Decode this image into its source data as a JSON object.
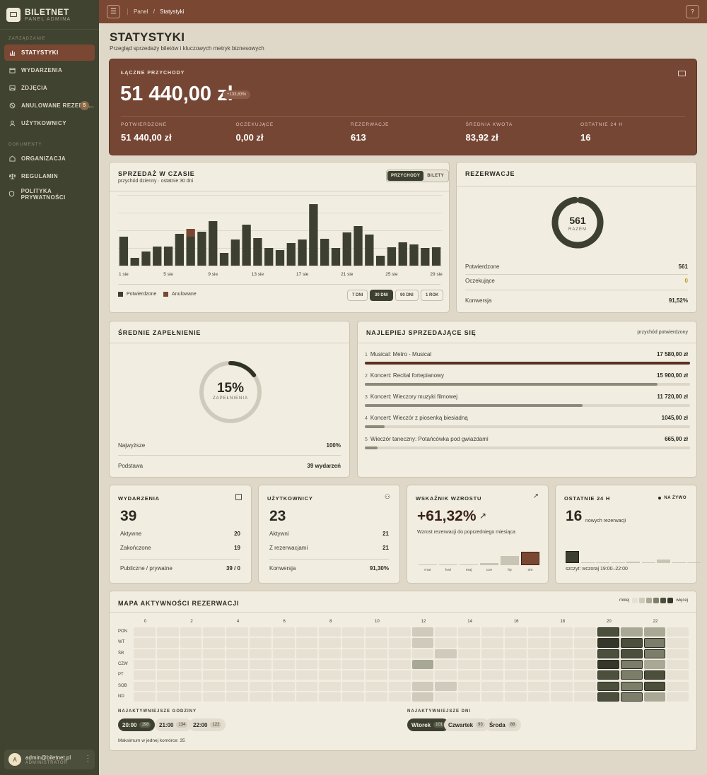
{
  "brand": {
    "name": "BILETNET",
    "sub": "PANEL ADMINA"
  },
  "sidebar": {
    "section1": "ZARZĄDZANIE",
    "items": [
      {
        "label": "STATYSTYKI",
        "icon": "bar-chart-icon",
        "active": true
      },
      {
        "label": "WYDARZENIA",
        "icon": "calendar-icon"
      },
      {
        "label": "ZDJĘCIA",
        "icon": "image-icon"
      },
      {
        "label": "ANULOWANE REZERW...",
        "icon": "cancel-icon",
        "badge": "5"
      },
      {
        "label": "UŻYTKOWNICY",
        "icon": "user-icon"
      }
    ],
    "section2": "DOKUMENTY",
    "docs": [
      {
        "label": "ORGANIZACJA",
        "icon": "building-icon"
      },
      {
        "label": "REGULAMIN",
        "icon": "scale-icon"
      },
      {
        "label": "POLITYKA PRYWATNOŚCI",
        "icon": "shield-icon"
      }
    ],
    "user": {
      "avatar": "A",
      "email": "admin@biletnet.pl",
      "role": "ADMINISTRATOR"
    }
  },
  "topbar": {
    "crumb_root": "Panel",
    "crumb_sep": "/",
    "crumb_current": "Statystyki",
    "help": "?"
  },
  "page": {
    "title": "STATYSTYKI",
    "subtitle": "Przegląd sprzedaży biletów i kluczowych metryk biznesowych"
  },
  "hero": {
    "label": "ŁĄCZNE PRZYCHODY",
    "value": "51 440,00 zł",
    "delta": "+133,83%",
    "stats": [
      {
        "label": "POTWIERDZONE",
        "value": "51 440,00 zł"
      },
      {
        "label": "OCZEKUJĄCE",
        "value": "0,00 zł"
      },
      {
        "label": "REZERWACJE",
        "value": "613"
      },
      {
        "label": "ŚREDNIA KWOTA",
        "value": "83,92 zł"
      },
      {
        "label": "OSTATNIE 24 H",
        "value": "16"
      }
    ]
  },
  "sales": {
    "title": "SPRZEDAŻ W CZASIE",
    "subtitle": "przychód dzienny · ostatnie 30 dni",
    "toggle": [
      "PRZYCHODY",
      "BILETY"
    ],
    "legend_confirmed": "Potwierdzone",
    "legend_cancelled": "Anulowane",
    "ranges": [
      "7 DNI",
      "30 DNI",
      "90 DNI",
      "1 ROK"
    ],
    "colors": {
      "confirmed": "#3d4030",
      "cancelled": "#7a4733"
    }
  },
  "chart_data": {
    "type": "bar",
    "categories": [
      "1 sie",
      "2 sie",
      "3 sie",
      "4 sie",
      "5 sie",
      "6 sie",
      "7 sie",
      "8 sie",
      "9 sie",
      "10 sie",
      "11 sie",
      "12 sie",
      "13 sie",
      "14 sie",
      "15 sie",
      "16 sie",
      "17 sie",
      "18 sie",
      "19 sie",
      "20 sie",
      "21 sie",
      "22 sie",
      "23 sie",
      "24 sie",
      "25 sie",
      "26 sie",
      "27 sie",
      "28 sie",
      "29 sie"
    ],
    "tick_labels": [
      "1 sie",
      "5 sie",
      "9 sie",
      "13 sie",
      "17 sie",
      "21 sie",
      "25 sie",
      "29 sie"
    ],
    "series": [
      {
        "name": "Potwierdzone",
        "values": [
          41,
          11,
          20,
          27,
          27,
          45,
          41,
          48,
          63,
          18,
          37,
          58,
          39,
          25,
          22,
          32,
          37,
          87,
          38,
          25,
          47,
          56,
          44,
          14,
          26,
          33,
          30,
          25,
          26
        ]
      },
      {
        "name": "Anulowane",
        "values": [
          0,
          0,
          0,
          0,
          0,
          0,
          11,
          0,
          0,
          0,
          0,
          0,
          0,
          0,
          0,
          0,
          0,
          0,
          0,
          0,
          0,
          0,
          0,
          0,
          0,
          0,
          0,
          0,
          0
        ]
      }
    ],
    "ylim": [
      0,
      100
    ]
  },
  "reservations": {
    "title": "REZERWACJE",
    "total": "561",
    "total_label": "RAZEM",
    "confirmed_fraction": 0.96,
    "rows": [
      {
        "label": "Potwierdzone",
        "value": "561"
      },
      {
        "label": "Oczekujące",
        "value": "0"
      },
      {
        "label": "Konwersja",
        "value": "91,52%"
      }
    ]
  },
  "occupancy": {
    "title": "ŚREDNIE ZAPEŁNIENIE",
    "value": "15%",
    "value_label": "ZAPEŁNIENIA",
    "fraction": 0.15,
    "rows": [
      {
        "label": "Najwyższe",
        "value": "100%"
      },
      {
        "label": "Podstawa",
        "value": "39 wydarzeń"
      }
    ]
  },
  "bestsellers": {
    "title": "NAJLEPIEJ SPRZEDAJĄCE SIĘ",
    "note": "przychód potwierdzony",
    "items": [
      {
        "rank": "1",
        "name": "Musical: Metro - Musical",
        "value": "17 580,00 zł",
        "fraction": 1.0
      },
      {
        "rank": "2",
        "name": "Koncert: Recital fortepianowy",
        "value": "15 900,00 zł",
        "fraction": 0.9
      },
      {
        "rank": "3",
        "name": "Koncert: Wieczory muzyki filmowej",
        "value": "11 720,00 zł",
        "fraction": 0.67
      },
      {
        "rank": "4",
        "name": "Koncert: Wieczór z piosenką biesiadną",
        "value": "1045,00 zł",
        "fraction": 0.06
      },
      {
        "rank": "5",
        "name": "Wieczór taneczny: Potańcówka pod gwiazdami",
        "value": "665,00 zł",
        "fraction": 0.04
      }
    ]
  },
  "events_card": {
    "title": "WYDARZENIA",
    "value": "39",
    "rows": [
      {
        "label": "Aktywne",
        "value": "20"
      },
      {
        "label": "Zakończone",
        "value": "19"
      },
      {
        "label": "Publiczne / prywatne",
        "value": "39 / 0"
      }
    ]
  },
  "users_card": {
    "title": "UŻYTKOWNICY",
    "value": "23",
    "rows": [
      {
        "label": "Aktywni",
        "value": "21"
      },
      {
        "label": "Z rezerwacjami",
        "value": "21"
      },
      {
        "label": "Konwersja",
        "value": "91,30%"
      }
    ]
  },
  "growth_card": {
    "title": "WSKAŹNIK WZROSTU",
    "value": "+61,32%",
    "desc": "Wzrost rezerwacji do poprzedniego miesiąca",
    "months": [
      "mar",
      "kwi",
      "maj",
      "cze",
      "lip",
      "sie"
    ],
    "month_values": [
      1,
      1,
      1,
      3,
      13,
      19
    ]
  },
  "last24_card": {
    "title": "OSTATNIE 24 H",
    "live": "NA ŻYWO",
    "value": "16",
    "value_label": "nowych rezerwacji",
    "peak": "szczyt: wczoraj 19:00–22:00",
    "hour_values": [
      16,
      1,
      1,
      1,
      2,
      1,
      5,
      1,
      1
    ]
  },
  "heatmap": {
    "title": "MAPA AKTYWNOŚCI REZERWACJI",
    "less": "mniej",
    "more": "więcej",
    "days": [
      "PON",
      "WT",
      "ŚR",
      "CZW",
      "PT",
      "SOB",
      "ND"
    ],
    "hour_labels": [
      "0",
      "2",
      "4",
      "6",
      "8",
      "10",
      "12",
      "14",
      "16",
      "18",
      "20",
      "22"
    ],
    "grid": [
      [
        0,
        0,
        0,
        0,
        0,
        0,
        0,
        0,
        0,
        0,
        0,
        0,
        1,
        0,
        0,
        0,
        0,
        0,
        0,
        0,
        4,
        2,
        2,
        0
      ],
      [
        0,
        0,
        0,
        0,
        0,
        0,
        0,
        0,
        0,
        0,
        0,
        0,
        1,
        0,
        0,
        0,
        0,
        0,
        0,
        0,
        5,
        4,
        3,
        0
      ],
      [
        0,
        0,
        0,
        0,
        0,
        0,
        0,
        0,
        0,
        0,
        0,
        0,
        0,
        1,
        0,
        0,
        0,
        0,
        0,
        0,
        4,
        4,
        3,
        0
      ],
      [
        0,
        0,
        0,
        0,
        0,
        0,
        0,
        0,
        0,
        0,
        0,
        0,
        2,
        0,
        0,
        0,
        0,
        0,
        0,
        0,
        5,
        3,
        2,
        0
      ],
      [
        0,
        0,
        0,
        0,
        0,
        0,
        0,
        0,
        0,
        0,
        0,
        0,
        0,
        0,
        0,
        0,
        0,
        0,
        0,
        0,
        4,
        3,
        4,
        0
      ],
      [
        0,
        0,
        0,
        0,
        0,
        0,
        0,
        0,
        0,
        0,
        0,
        0,
        1,
        1,
        0,
        0,
        0,
        0,
        0,
        0,
        4,
        3,
        4,
        0
      ],
      [
        0,
        0,
        0,
        0,
        0,
        0,
        0,
        0,
        0,
        0,
        0,
        0,
        1,
        0,
        0,
        0,
        0,
        0,
        0,
        0,
        4,
        3,
        2,
        0
      ]
    ],
    "scale_colors": [
      "#e6e1d3",
      "#cfcabb",
      "#a9a796",
      "#7c7e6a",
      "#4b4f3b",
      "#34372a"
    ],
    "hours_title": "NAJAKTYWNIEJSZE GODZINY",
    "hours": [
      {
        "label": "20:00",
        "count": "198"
      },
      {
        "label": "21:00",
        "count": "134"
      },
      {
        "label": "22:00",
        "count": "122"
      }
    ],
    "days_title": "NAJAKTYWNIEJSZE DNI",
    "top_days": [
      {
        "label": "Wtorek",
        "count": "101"
      },
      {
        "label": "Czwartek",
        "count": "93"
      },
      {
        "label": "Środa",
        "count": "88"
      }
    ],
    "max_note": "Maksimum w jednej komórce: 35"
  }
}
